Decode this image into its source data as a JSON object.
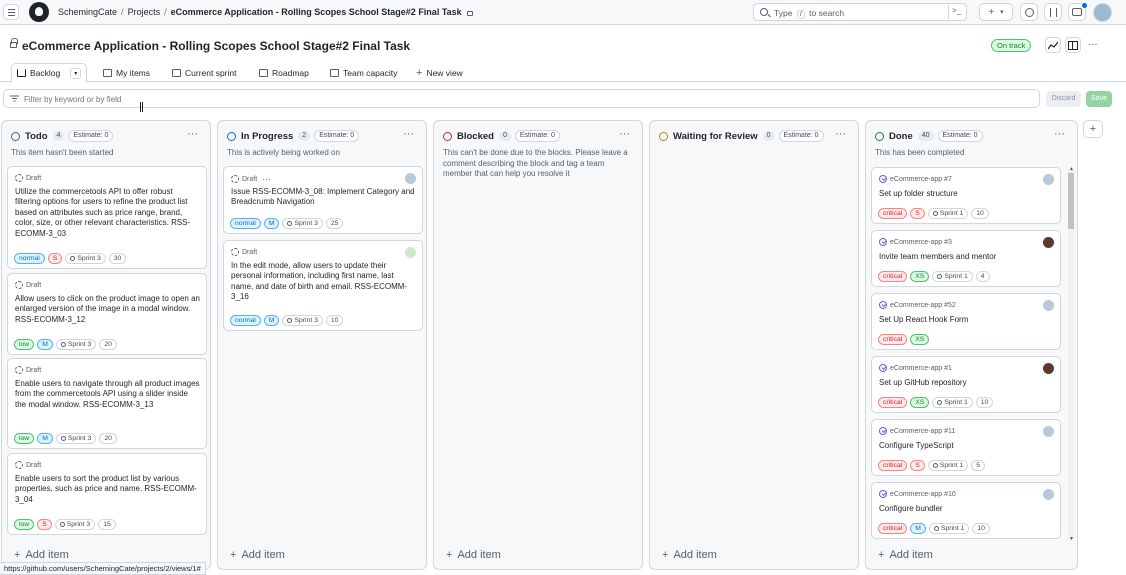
{
  "header": {
    "breadcrumb_user": "SchemingCate",
    "breadcrumb_projects": "Projects",
    "breadcrumb_project": "eCommerce Application - Rolling Scopes School Stage#2 Final Task",
    "search_prefix": "Type",
    "search_slash": "/",
    "search_suffix": "to search",
    "cmd_icon": ">_",
    "plus": "+",
    "caret": "▾"
  },
  "project": {
    "title": "eCommerce Application - Rolling Scopes School Stage#2 Final Task",
    "status": "On track",
    "more": "···"
  },
  "tabs": [
    {
      "label": "Backlog"
    },
    {
      "label": "My items"
    },
    {
      "label": "Current sprint"
    },
    {
      "label": "Roadmap"
    },
    {
      "label": "Team capacity"
    },
    {
      "label": "New view"
    }
  ],
  "filter": {
    "placeholder": "Filter by keyword or by field",
    "discard": "Discard",
    "save": "Save"
  },
  "columns": [
    {
      "title": "Todo",
      "count": "4",
      "estimate": "Estimate: 0",
      "color": "#57606a",
      "description": "This item hasn't been started",
      "cards": [
        {
          "meta": "Draft",
          "text": "Utilize the commercetools API to offer robust filtering options for users to refine the product list based on attributes such as price range, brand, color, size, or other relevant characteristics. RSS-ECOMM-3_03",
          "priority": "normal",
          "size": "S",
          "sprint": "Sprint 3",
          "estimate": "30"
        },
        {
          "meta": "Draft",
          "text": "Allow users to click on the product image to open an enlarged version of the image in a modal window. RSS-ECOMM-3_12",
          "priority": "low",
          "size": "M",
          "sprint": "Sprint 3",
          "estimate": "20"
        },
        {
          "meta": "Draft",
          "text": "Enable users to navigate through all product images from the commercetools API using a slider inside the modal window. RSS-ECOMM-3_13",
          "priority": "low",
          "size": "M",
          "sprint": "Sprint 3",
          "estimate": "20"
        },
        {
          "meta": "Draft",
          "text": "Enable users to sort the product list by various properties, such as price and name. RSS-ECOMM-3_04",
          "priority": "low",
          "size": "S",
          "sprint": "Sprint 3",
          "estimate": "15"
        }
      ],
      "add_item": "Add item"
    },
    {
      "title": "In Progress",
      "count": "2",
      "estimate": "Estimate: 0",
      "color": "#0969da",
      "description": "This is actively being worked on",
      "cards": [
        {
          "meta": "Draft",
          "text": "Issue RSS-ECOMM-3_08: Implement Category and Breadcrumb Navigation",
          "priority": "normal",
          "size": "M",
          "sprint": "Sprint 3",
          "estimate": "25"
        },
        {
          "meta": "Draft",
          "text": "In the edit mode, allow users to update their personal information, including first name, last name, and date of birth and email. RSS-ECOMM-3_16",
          "priority": "normal",
          "size": "M",
          "sprint": "Sprint 3",
          "estimate": "10"
        }
      ],
      "add_item": "Add item"
    },
    {
      "title": "Blocked",
      "count": "0",
      "estimate": "Estimate: 0",
      "color": "#cf222e",
      "description": "This can't be done due to the blocks. Please leave a comment describing the block and tag a team member that can help you resolve it",
      "cards": [],
      "add_item": "Add item"
    },
    {
      "title": "Waiting for Review",
      "count": "0",
      "estimate": "Estimate: 0",
      "color": "#bf8700",
      "description": "",
      "cards": [],
      "add_item": "Add item"
    },
    {
      "title": "Done",
      "count": "40",
      "estimate": "Estimate: 0",
      "color": "#1a7f37",
      "description": "This has been completed",
      "cards": [
        {
          "meta": "eCommerce-app #7",
          "text": "Set up folder structure",
          "priority": "critical",
          "size": "S",
          "sprint": "Sprint 1",
          "estimate": "10"
        },
        {
          "meta": "eCommerce-app #3",
          "text": "Invite team members and mentor",
          "priority": "critical",
          "size": "XS",
          "sprint": "Sprint 1",
          "estimate": "4"
        },
        {
          "meta": "eCommerce-app #52",
          "text": "Set Up React Hook Form",
          "priority": "critical",
          "size": "XS",
          "sprint": "",
          "estimate": ""
        },
        {
          "meta": "eCommerce-app #1",
          "text": "Set up GitHub repository",
          "priority": "critical",
          "size": "XS",
          "sprint": "Sprint 1",
          "estimate": "10"
        },
        {
          "meta": "eCommerce-app #11",
          "text": "Configure TypeScript",
          "priority": "critical",
          "size": "S",
          "sprint": "Sprint 1",
          "estimate": "5"
        },
        {
          "meta": "eCommerce-app #10",
          "text": "Configure bundler",
          "priority": "critical",
          "size": "M",
          "sprint": "Sprint 1",
          "estimate": "10"
        }
      ],
      "add_item": "Add item"
    }
  ],
  "statusbar": "https://github.com/users/SchemingCate/projects/2/views/1#"
}
